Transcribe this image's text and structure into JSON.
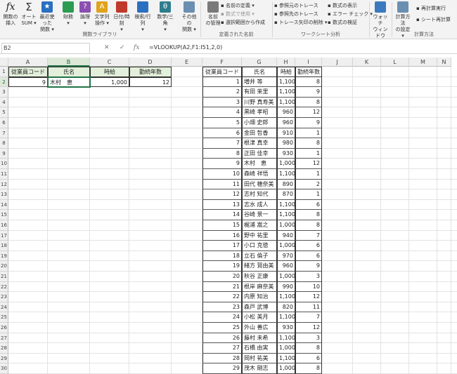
{
  "ribbon": {
    "buttons": [
      {
        "name": "insert-function-button",
        "icon": "fx",
        "label1": "関数の",
        "label2": "挿入"
      },
      {
        "name": "autosum-button",
        "icon": "Σ",
        "label1": "オート",
        "label2": "SUM ▾"
      },
      {
        "name": "recent-button",
        "icon": "★",
        "label1": "最近使った",
        "label2": "関数 ▾"
      },
      {
        "name": "financial-button",
        "icon": "",
        "label1": "財務",
        "label2": "▾"
      },
      {
        "name": "logical-button",
        "icon": "?",
        "label1": "論理",
        "label2": "▾"
      },
      {
        "name": "text-button",
        "icon": "A",
        "label1": "文字列",
        "label2": "操作 ▾"
      },
      {
        "name": "datetime-button",
        "icon": "",
        "label1": "日付/時刻",
        "label2": "▾"
      },
      {
        "name": "lookup-button",
        "icon": "",
        "label1": "検索/行列",
        "label2": "▾"
      },
      {
        "name": "math-button",
        "icon": "θ",
        "label1": "数学/三角",
        "label2": "▾"
      },
      {
        "name": "more-functions-button",
        "icon": "",
        "label1": "その他の",
        "label2": "関数 ▾"
      },
      {
        "name": "name-manager-button",
        "icon": "",
        "label1": "名前",
        "label2": "の管理"
      },
      {
        "name": "watch-window-button",
        "icon": "",
        "label1": "ウォッチ",
        "label2": "ウィンドウ"
      },
      {
        "name": "calc-options-button",
        "icon": "",
        "label1": "計算方法",
        "label2": "の設定 ▾"
      }
    ],
    "small": {
      "define_name": "名前の定義 ▾",
      "use_in_formula": "数式で使用 ▾",
      "create_from_selection": "選択範囲から作成",
      "trace_precedents": "参照元のトレース",
      "trace_dependents": "参照先のトレース",
      "remove_arrows": "トレース矢印の削除 ▾",
      "show_formulas": "数式の表示",
      "error_checking": "エラー チェック ▾",
      "evaluate_formula": "数式の検証",
      "calc_now": "再計算実行",
      "calc_sheet": "シート再計算"
    },
    "groups": {
      "library": "関数ライブラリ",
      "names": "定義された名前",
      "auditing": "ワークシート分析",
      "calculation": "計算方法"
    }
  },
  "formula_bar": {
    "name_box": "B2",
    "cancel": "✕",
    "enter": "✓",
    "fx": "fx",
    "formula": "=VLOOKUP(A2,F1:I51,2,0)"
  },
  "columns": [
    "A",
    "B",
    "C",
    "D",
    "E",
    "F",
    "G",
    "H",
    "I",
    "J",
    "K",
    "L",
    "M",
    "N"
  ],
  "rows": [
    "1",
    "2",
    "3",
    "4",
    "5",
    "6",
    "7",
    "8",
    "9",
    "10",
    "11",
    "12",
    "13",
    "14",
    "15",
    "16",
    "17",
    "18",
    "19",
    "20",
    "21",
    "22",
    "23",
    "24",
    "25",
    "26",
    "27",
    "28",
    "29",
    "30"
  ],
  "lookup_form": {
    "headers": [
      "従業員コード",
      "氏名",
      "時給",
      "勤続年数"
    ],
    "values": [
      "9",
      "木村　恵",
      "1,000",
      "12"
    ]
  },
  "table": {
    "headers": [
      "従業員コード",
      "氏名",
      "時給",
      "勤続年数"
    ],
    "rows": [
      [
        "1",
        "増井 等",
        "1,100",
        "8"
      ],
      [
        "2",
        "有田 茉里",
        "1,100",
        "9"
      ],
      [
        "3",
        "川野 真寿美",
        "1,100",
        "8"
      ],
      [
        "4",
        "黒崎 孝昭",
        "960",
        "12"
      ],
      [
        "5",
        "小畑 史郎",
        "960",
        "9"
      ],
      [
        "6",
        "金田 哲香",
        "910",
        "1"
      ],
      [
        "7",
        "根津 真幸",
        "980",
        "8"
      ],
      [
        "8",
        "正田 佳幸",
        "930",
        "1"
      ],
      [
        "9",
        "木村　恵",
        "1,000",
        "12"
      ],
      [
        "10",
        "森崎 祥悟",
        "1,100",
        "1"
      ],
      [
        "11",
        "田代 穂奈美",
        "890",
        "2"
      ],
      [
        "12",
        "志村 知代",
        "870",
        "1"
      ],
      [
        "13",
        "志水 成人",
        "1,100",
        "6"
      ],
      [
        "14",
        "谷崎 景一",
        "1,100",
        "8"
      ],
      [
        "15",
        "梶浦 嵩之",
        "1,000",
        "8"
      ],
      [
        "16",
        "野中 祐里",
        "940",
        "7"
      ],
      [
        "17",
        "小口 克徳",
        "1,000",
        "6"
      ],
      [
        "18",
        "立石 倫子",
        "970",
        "6"
      ],
      [
        "19",
        "緒方 賀由美",
        "960",
        "9"
      ],
      [
        "20",
        "秋谷 正康",
        "1,000",
        "3"
      ],
      [
        "21",
        "根岸 麻奈美",
        "990",
        "10"
      ],
      [
        "22",
        "内原 知治",
        "1,100",
        "12"
      ],
      [
        "23",
        "森戸 武博",
        "820",
        "11"
      ],
      [
        "24",
        "小松 美月",
        "1,100",
        "7"
      ],
      [
        "25",
        "外山 善広",
        "930",
        "12"
      ],
      [
        "26",
        "藤村 未希",
        "1,100",
        "3"
      ],
      [
        "27",
        "石橋 由実",
        "1,000",
        "8"
      ],
      [
        "28",
        "岡村 祐美",
        "1,100",
        "6"
      ],
      [
        "29",
        "茂木 剛志",
        "1,000",
        "8"
      ]
    ]
  }
}
